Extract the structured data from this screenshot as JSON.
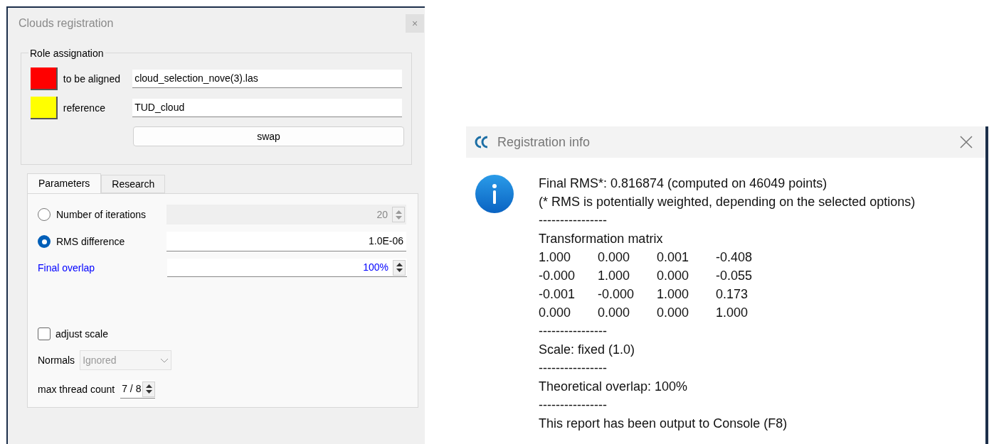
{
  "clouds_registration": {
    "title": "Clouds registration",
    "close": "×",
    "role_assignation": {
      "title": "Role assignation",
      "rows": [
        {
          "label": "to be aligned",
          "value": "cloud_selection_nove(3).las",
          "color": "#ff0000"
        },
        {
          "label": "reference",
          "value": "TUD_cloud",
          "color": "#ffff00"
        }
      ],
      "swap": "swap"
    },
    "tabs": [
      {
        "label": "Parameters",
        "selected": true
      },
      {
        "label": "Research",
        "selected": false
      }
    ],
    "stop_criteria": [
      {
        "label": "Number of iterations",
        "value": "20",
        "selected": false,
        "spin": true
      },
      {
        "label": "RMS difference",
        "value": "1.0E-06",
        "selected": true,
        "spin": false
      }
    ],
    "final_overlap": {
      "label": "Final overlap",
      "value": "100%"
    },
    "adjust_scale": {
      "label": "adjust scale",
      "checked": false
    },
    "normals": {
      "label": "Normals",
      "value": "Ignored",
      "disabled": true
    },
    "max_thread_count": {
      "label": "max thread count",
      "value": "7 / 8"
    }
  },
  "registration_info": {
    "title": "Registration info",
    "lines": [
      {
        "kind": "text",
        "text": "Final RMS*: 0.816874 (computed on 46049 points)"
      },
      {
        "kind": "text",
        "text": "(* RMS is potentially weighted, depending on the selected options)"
      },
      {
        "kind": "text",
        "text": "----------------"
      },
      {
        "kind": "text",
        "text": "Transformation matrix"
      },
      {
        "kind": "matrix",
        "cells": [
          "1.000",
          "0.000",
          "0.001",
          "-0.408"
        ]
      },
      {
        "kind": "matrix",
        "cells": [
          "-0.000",
          "1.000",
          "0.000",
          "-0.055"
        ]
      },
      {
        "kind": "matrix",
        "cells": [
          "-0.001",
          "-0.000",
          "1.000",
          "0.173"
        ]
      },
      {
        "kind": "matrix",
        "cells": [
          "0.000",
          "0.000",
          "0.000",
          "1.000"
        ]
      },
      {
        "kind": "text",
        "text": "----------------"
      },
      {
        "kind": "text",
        "text": "Scale: fixed (1.0)"
      },
      {
        "kind": "text",
        "text": "----------------"
      },
      {
        "kind": "text",
        "text": "Theoretical overlap: 100%"
      },
      {
        "kind": "text",
        "text": "----------------"
      },
      {
        "kind": "text",
        "text": "This report has been output to Console (F8)"
      }
    ]
  }
}
